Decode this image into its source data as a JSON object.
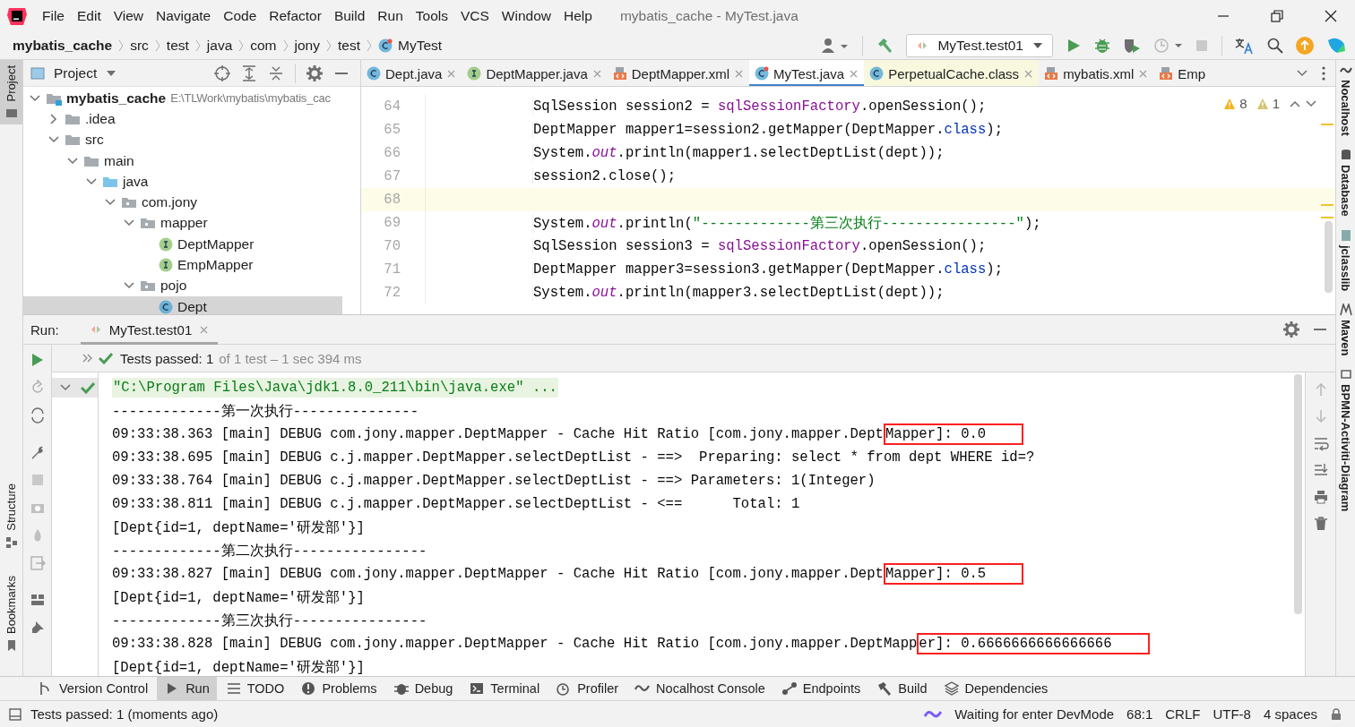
{
  "menu_bar": {
    "items": [
      "File",
      "Edit",
      "View",
      "Navigate",
      "Code",
      "Refactor",
      "Build",
      "Run",
      "Tools",
      "VCS",
      "Window",
      "Help"
    ],
    "title": "mybatis_cache - MyTest.java"
  },
  "navigation_bar": {
    "breadcrumbs": [
      "mybatis_cache",
      "src",
      "test",
      "java",
      "com",
      "jony",
      "test",
      "MyTest"
    ],
    "run_configuration": "MyTest.test01"
  },
  "left_tool_strip": [
    {
      "label": "Project",
      "selected": true
    },
    {
      "label": "Structure",
      "selected": false
    },
    {
      "label": "Bookmarks",
      "selected": false
    }
  ],
  "right_tool_strip": [
    "Nocalhost",
    "Database",
    "jclasslib",
    "Maven",
    "BPMN-Activiti-Diagram"
  ],
  "project_panel": {
    "title": "Project",
    "tree": [
      {
        "label": "mybatis_cache",
        "path": "E:\\TLWork\\mybatis\\mybatis_cac",
        "kind": "module",
        "expanded": true,
        "selected": false,
        "children": [
          {
            "label": ".idea",
            "kind": "folder",
            "expanded": false,
            "selected": false
          },
          {
            "label": "src",
            "kind": "folder",
            "expanded": true,
            "selected": false,
            "children": [
              {
                "label": "main",
                "kind": "folder",
                "expanded": true,
                "selected": false,
                "children": [
                  {
                    "label": "java",
                    "kind": "source",
                    "expanded": true,
                    "selected": false,
                    "children": [
                      {
                        "label": "com.jony",
                        "kind": "package",
                        "expanded": true,
                        "selected": false,
                        "children": [
                          {
                            "label": "mapper",
                            "kind": "package",
                            "expanded": true,
                            "selected": false,
                            "children": [
                              {
                                "label": "DeptMapper",
                                "kind": "interface",
                                "expanded": false,
                                "selected": false
                              },
                              {
                                "label": "EmpMapper",
                                "kind": "interface",
                                "expanded": false,
                                "selected": false
                              }
                            ]
                          },
                          {
                            "label": "pojo",
                            "kind": "package",
                            "expanded": true,
                            "selected": false,
                            "children": [
                              {
                                "label": "Dept",
                                "kind": "class",
                                "expanded": false,
                                "selected": true
                              }
                            ]
                          }
                        ]
                      }
                    ]
                  }
                ]
              }
            ]
          }
        ]
      }
    ]
  },
  "editor": {
    "tabs": [
      {
        "label": "Dept.java",
        "kind": "class",
        "selected": false,
        "library": false,
        "closable": true
      },
      {
        "label": "DeptMapper.java",
        "kind": "interface",
        "selected": false,
        "library": false,
        "closable": true
      },
      {
        "label": "DeptMapper.xml",
        "kind": "xml",
        "selected": false,
        "library": false,
        "closable": true
      },
      {
        "label": "MyTest.java",
        "kind": "test",
        "selected": true,
        "library": false,
        "closable": true
      },
      {
        "label": "PerpetualCache.class",
        "kind": "class",
        "selected": false,
        "library": true,
        "closable": true
      },
      {
        "label": "mybatis.xml",
        "kind": "xml",
        "selected": false,
        "library": false,
        "closable": true
      },
      {
        "label": "Emp",
        "kind": "xml",
        "selected": false,
        "library": false,
        "closable": false
      }
    ],
    "inspections": {
      "warnings": "8",
      "weak_warnings": "1"
    },
    "lines": [
      {
        "number": "64",
        "current": false,
        "tokens": [
          {
            "text": "SqlSession session2 = ",
            "kind": "plain"
          },
          {
            "text": "sqlSessionFactory",
            "kind": "field"
          },
          {
            "text": ".openSession();",
            "kind": "plain"
          }
        ]
      },
      {
        "number": "65",
        "current": false,
        "tokens": [
          {
            "text": "DeptMapper mapper1=session2.getMapper(DeptMapper.",
            "kind": "plain"
          },
          {
            "text": "class",
            "kind": "keyword"
          },
          {
            "text": ");",
            "kind": "plain"
          }
        ]
      },
      {
        "number": "66",
        "current": false,
        "tokens": [
          {
            "text": "System.",
            "kind": "plain"
          },
          {
            "text": "out",
            "kind": "static"
          },
          {
            "text": ".println(mapper1.selectDeptList(dept));",
            "kind": "plain"
          }
        ]
      },
      {
        "number": "67",
        "current": false,
        "tokens": [
          {
            "text": "session2.close();",
            "kind": "plain"
          }
        ]
      },
      {
        "number": "68",
        "current": true
      },
      {
        "number": "69",
        "current": false,
        "tokens": [
          {
            "text": "System.",
            "kind": "plain"
          },
          {
            "text": "out",
            "kind": "static"
          },
          {
            "text": ".println(",
            "kind": "plain"
          },
          {
            "text": "\"-------------第三次执行----------------\"",
            "kind": "string"
          },
          {
            "text": ");",
            "kind": "plain"
          }
        ]
      },
      {
        "number": "70",
        "current": false,
        "tokens": [
          {
            "text": "SqlSession session3 = ",
            "kind": "plain"
          },
          {
            "text": "sqlSessionFactory",
            "kind": "field"
          },
          {
            "text": ".openSession();",
            "kind": "plain"
          }
        ]
      },
      {
        "number": "71",
        "current": false,
        "tokens": [
          {
            "text": "DeptMapper mapper3=session3.getMapper(DeptMapper.",
            "kind": "plain"
          },
          {
            "text": "class",
            "kind": "keyword"
          },
          {
            "text": ");",
            "kind": "plain"
          }
        ]
      },
      {
        "number": "72",
        "current": false,
        "tokens": [
          {
            "text": "System.",
            "kind": "plain"
          },
          {
            "text": "out",
            "kind": "static"
          },
          {
            "text": ".println(mapper3.selectDeptList(dept));",
            "kind": "plain"
          }
        ]
      }
    ]
  },
  "run_panel": {
    "label": "Run:",
    "tab": "MyTest.test01",
    "status": "Tests passed: 1",
    "status_detail": "of 1 test – 1 sec 394 ms",
    "console": [
      {
        "kind": "command",
        "text": "\"C:\\Program Files\\Java\\jdk1.8.0_211\\bin\\java.exe\" ..."
      },
      {
        "kind": "output",
        "text": "-------------第一次执行---------------"
      },
      {
        "kind": "output",
        "text": "09:33:38.363 [main] DEBUG com.jony.mapper.DeptMapper - Cache Hit Ratio [com.jony.mapper.Dept",
        "boxed_text": "Mapper]: 0.0"
      },
      {
        "kind": "output",
        "text": "09:33:38.695 [main] DEBUG c.j.mapper.DeptMapper.selectDeptList - ==>  Preparing: select * from dept WHERE id=?"
      },
      {
        "kind": "output",
        "text": "09:33:38.764 [main] DEBUG c.j.mapper.DeptMapper.selectDeptList - ==> Parameters: 1(Integer)"
      },
      {
        "kind": "output",
        "text": "09:33:38.811 [main] DEBUG c.j.mapper.DeptMapper.selectDeptList - <==      Total: 1"
      },
      {
        "kind": "output",
        "text": "[Dept{id=1, deptName='研发部'}]"
      },
      {
        "kind": "output",
        "text": "-------------第二次执行----------------"
      },
      {
        "kind": "output",
        "text": "09:33:38.827 [main] DEBUG com.jony.mapper.DeptMapper - Cache Hit Ratio [com.jony.mapper.Dept",
        "boxed_text": "Mapper]: 0.5"
      },
      {
        "kind": "output",
        "text": "[Dept{id=1, deptName='研发部'}]"
      },
      {
        "kind": "output",
        "text": "-------------第三次执行----------------"
      },
      {
        "kind": "output",
        "text": "09:33:38.828 [main] DEBUG com.jony.mapper.DeptMapper - Cache Hit Ratio [com.jony.mapper.DeptMapp",
        "boxed_text": "er]: 0.6666666666666666"
      },
      {
        "kind": "output",
        "text": "[Dept{id=1, deptName='研发部'}]"
      }
    ]
  },
  "tool_window_tabs": [
    {
      "label": "Version Control",
      "selected": false
    },
    {
      "label": "Run",
      "selected": true
    },
    {
      "label": "TODO",
      "selected": false
    },
    {
      "label": "Problems",
      "selected": false
    },
    {
      "label": "Debug",
      "selected": false
    },
    {
      "label": "Terminal",
      "selected": false
    },
    {
      "label": "Profiler",
      "selected": false
    },
    {
      "label": "Nocalhost Console",
      "selected": false
    },
    {
      "label": "Endpoints",
      "selected": false
    },
    {
      "label": "Build",
      "selected": false
    },
    {
      "label": "Dependencies",
      "selected": false
    }
  ],
  "status_bar": {
    "message": "Tests passed: 1 (moments ago)",
    "devmode": "Waiting for enter DevMode",
    "position": "68:1",
    "line_separator": "CRLF",
    "encoding": "UTF-8",
    "indent": "4 spaces"
  }
}
